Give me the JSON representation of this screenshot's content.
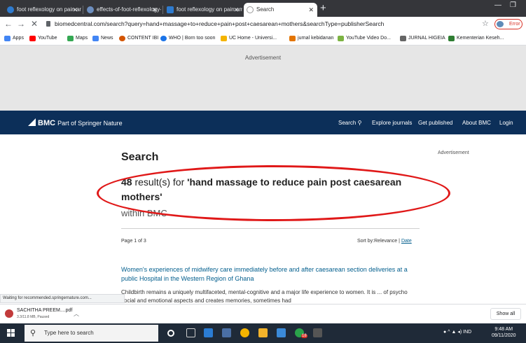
{
  "browser": {
    "tabs": [
      {
        "title": "foot reflexology on pain among y"
      },
      {
        "title": "effects-of-foot-reflexology-on-p"
      },
      {
        "title": "foot reflexology on pain among y"
      },
      {
        "title": "Search"
      }
    ],
    "url": "biomedcentral.com/search?query=hand+massage+to+reduce+pain+post+caesarean+mothers&searchType=publisherSearch",
    "error_label": "Error",
    "bookmarks": [
      {
        "label": "Apps",
        "color": "#4285f4"
      },
      {
        "label": "YouTube",
        "color": "#ff0000"
      },
      {
        "label": "Maps",
        "color": "#34a853"
      },
      {
        "label": "News",
        "color": "#4285f4"
      },
      {
        "label": "CONTENT IBI",
        "color": "#d35400"
      },
      {
        "label": "WHO | Born too soon",
        "color": "#1a73e8"
      },
      {
        "label": "UC Home - Universi...",
        "color": "#f4b400"
      },
      {
        "label": "jurnal kebidanan",
        "color": "#e37400"
      },
      {
        "label": "YouTube Video Do...",
        "color": "#7cb342"
      },
      {
        "label": "JURNAL HIGEIA",
        "color": "#666666"
      },
      {
        "label": "Kementerian Keseh...",
        "color": "#2e7d32"
      }
    ]
  },
  "page": {
    "ad_label": "Advertisement",
    "header": {
      "logo": "BMC",
      "subtitle": "Part of Springer Nature",
      "nav": [
        "Search",
        "Explore journals",
        "Get published",
        "About BMC",
        "Login"
      ]
    },
    "title": "Search",
    "ad_right": "Advertisement",
    "results": {
      "count": "48",
      "text": " result(s) for ",
      "query": "'hand massage to reduce pain post caesarean mothers'",
      "within": "within BMC"
    },
    "pagination": "Page 1 of 3",
    "sort": {
      "label": "Sort by:",
      "current": "Relevance",
      "separator": "|",
      "alt": "Date"
    },
    "article": {
      "title": "Women's experiences of midwifery care immediately before and after caesarean section deliveries at a public Hospital in the Western Region of Ghana",
      "snippet": "Childbirth remains a uniquely multifaceted, mental-cognitive and a major life experience to women. It is ... of psycho social and emotional aspects and creates memories, sometimes had"
    }
  },
  "status": "Waiting for recommended.springernature.com...",
  "download": {
    "name": "SACHITHA PREEM....pdf",
    "status": "3.3/11.8 MB, Paused",
    "show_all": "Show all"
  },
  "taskbar": {
    "search_placeholder": "Type here to search",
    "tray_lang": "IND",
    "time": "9:48 AM",
    "date": "09/11/2020",
    "badge": "18"
  },
  "colors": {
    "header_bg": "#0c2f59",
    "link": "#025e8d",
    "annotation": "#e01818"
  }
}
